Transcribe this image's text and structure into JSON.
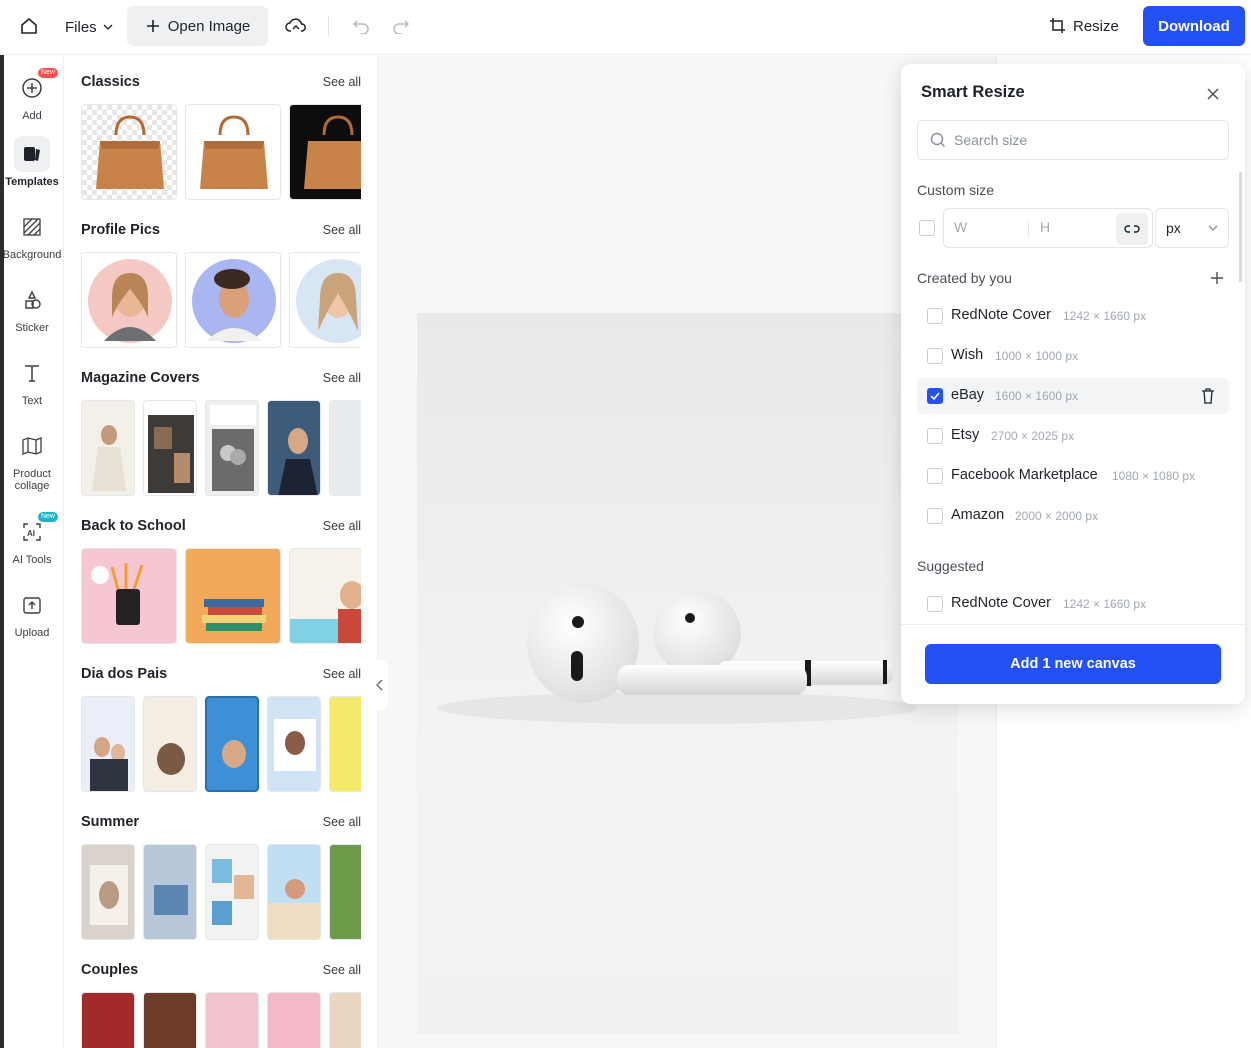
{
  "topbar": {
    "files_label": "Files",
    "open_image_label": "Open Image",
    "resize_label": "Resize",
    "download_label": "Download"
  },
  "rail": {
    "items": [
      {
        "label": "Add",
        "icon": "plus-circle-icon",
        "badge": "New"
      },
      {
        "label": "Templates",
        "icon": "templates-icon"
      },
      {
        "label": "Background",
        "icon": "background-hatch-icon"
      },
      {
        "label": "Sticker",
        "icon": "sticker-icon"
      },
      {
        "label": "Text",
        "icon": "text-icon"
      },
      {
        "label": "Product collage",
        "icon": "collage-icon"
      },
      {
        "label": "AI Tools",
        "icon": "ai-tools-icon",
        "badge": "New"
      },
      {
        "label": "Upload",
        "icon": "upload-icon"
      }
    ]
  },
  "panel": {
    "see_all": "See all",
    "sections": [
      {
        "title": "Classics"
      },
      {
        "title": "Profile Pics"
      },
      {
        "title": "Magazine Covers"
      },
      {
        "title": "Back to School"
      },
      {
        "title": "Dia dos Pais"
      },
      {
        "title": "Summer"
      },
      {
        "title": "Couples"
      }
    ]
  },
  "smart_resize": {
    "title": "Smart Resize",
    "search_placeholder": "Search size",
    "custom_size_label": "Custom size",
    "w_placeholder": "W",
    "h_placeholder": "H",
    "unit": "px",
    "created_by_you_label": "Created by you",
    "created": [
      {
        "name": "RedNote Cover",
        "dims": "1242 × 1660 px",
        "checked": false
      },
      {
        "name": "Wish",
        "dims": "1000 × 1000 px",
        "checked": false
      },
      {
        "name": "eBay",
        "dims": "1600 × 1600 px",
        "checked": true
      },
      {
        "name": "Etsy",
        "dims": "2700 × 2025 px",
        "checked": false
      },
      {
        "name": "Facebook Marketplace",
        "dims": "1080 × 1080 px",
        "checked": false
      },
      {
        "name": "Amazon",
        "dims": "2000 × 2000 px",
        "checked": false
      }
    ],
    "suggested_label": "Suggested",
    "suggested": [
      {
        "name": "RedNote Cover",
        "dims": "1242 × 1660 px",
        "checked": false
      }
    ],
    "add_button_label": "Add 1 new canvas"
  },
  "colors": {
    "accent": "#2451f5",
    "rail_badge_red": "#ff4d4f",
    "rail_badge_teal": "#19b4c8"
  }
}
